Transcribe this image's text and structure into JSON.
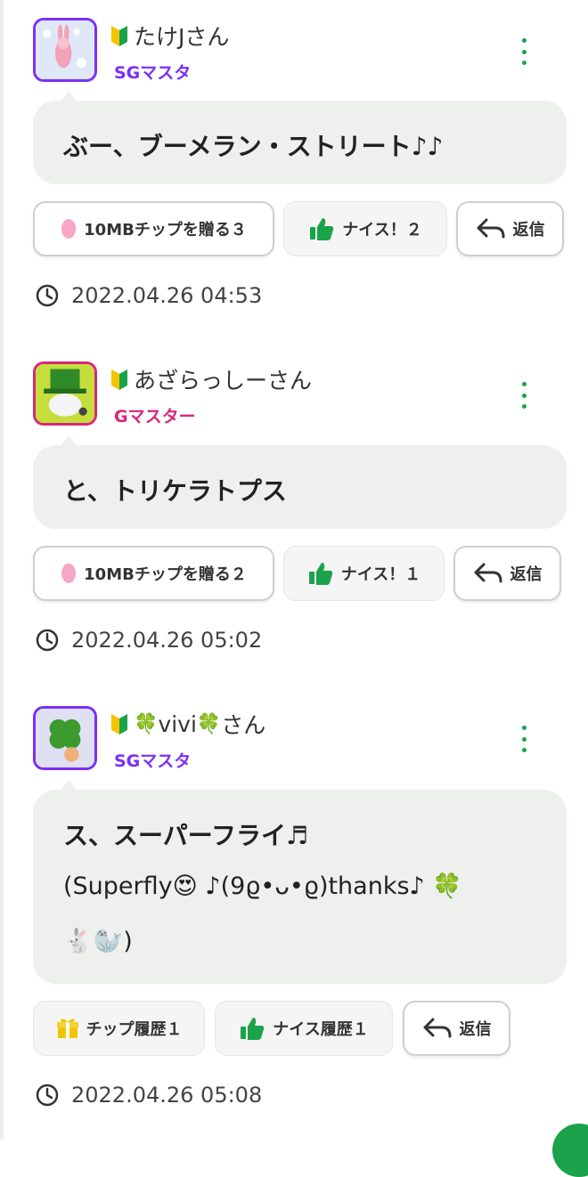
{
  "posts": [
    {
      "user": {
        "name": "たけJさん",
        "rank": "SGマスタ",
        "rank_color": "#7b2ff7",
        "avatar_border": "#7b2ff7"
      },
      "message": {
        "title": "ぶー、ブーメラン・ストリート♪♪",
        "lines": []
      },
      "actions": [
        {
          "label": "10MBチップを贈る３",
          "icon": "pink-petal-icon"
        },
        {
          "label": "ナイス！２",
          "icon": "thumbs-up-icon"
        },
        {
          "label": "返信",
          "icon": "reply-arrow-icon"
        }
      ],
      "timestamp": "2022.04.26 04:53"
    },
    {
      "user": {
        "name": "あざらっしーさん",
        "rank": "Gマスター",
        "rank_color": "#d6277a",
        "avatar_border": "#d6277a"
      },
      "message": {
        "title": "と、トリケラトプス",
        "lines": []
      },
      "actions": [
        {
          "label": "10MBチップを贈る２",
          "icon": "pink-petal-icon"
        },
        {
          "label": "ナイス！１",
          "icon": "thumbs-up-icon"
        },
        {
          "label": "返信",
          "icon": "reply-arrow-icon"
        }
      ],
      "timestamp": "2022.04.26 05:02"
    },
    {
      "user": {
        "name_prefix": "vivi",
        "name_suffix": "さん",
        "rank": "SGマスタ",
        "rank_color": "#7b2ff7",
        "avatar_border": "#7b2ff7"
      },
      "message": {
        "title": "ス、スーパーフライ♬",
        "lines": [
          "(Superfly😍 ♪(9ϱ•ᴗ•ϱ)thanks♪ 🍀",
          "🐇🦭)"
        ]
      },
      "actions": [
        {
          "label": "チップ履歴１",
          "icon": "gift-icon"
        },
        {
          "label": "ナイス履歴１",
          "icon": "thumbs-up-icon"
        },
        {
          "label": "返信",
          "icon": "reply-arrow-icon"
        }
      ],
      "timestamp": "2022.04.26 05:08"
    }
  ],
  "colors": {
    "accent_green": "#1aa34a",
    "bubble_bg": "#eef0ee"
  }
}
